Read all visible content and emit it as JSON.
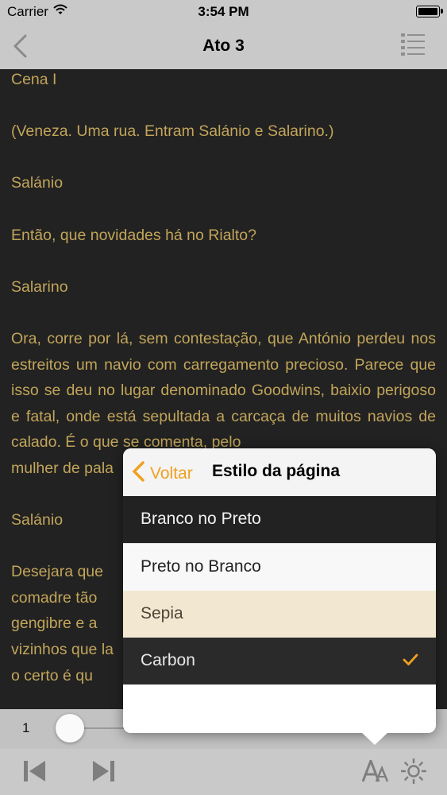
{
  "status_bar": {
    "carrier": "Carrier",
    "time": "3:54 PM"
  },
  "nav": {
    "title": "Ato 3",
    "back_icon": "chevron-left-icon",
    "toc_icon": "list-icon"
  },
  "content": {
    "paragraphs": [
      "Cena I",
      "(Veneza. Uma rua. Entram Salánio e Salarino.)",
      "Salánio",
      "Então, que novidades há no Rialto?",
      "Salarino",
      "Ora, corre por lá, sem contestação, que António perdeu nos estreitos um navio com carregamento precioso. Parece que isso se deu no lugar denominado Goodwins, baixio perigoso e fatal, onde está sepultada a carcaça de muitos navios de calado. É o que se comenta, pelo",
      "mulher de pala",
      "Salánio",
      "Desejara que",
      "comadre  tão",
      "gengibre  e  a",
      "vizinhos que la",
      "o  certo  é  qu"
    ]
  },
  "popover": {
    "back_label": "Voltar",
    "title": "Estilo da página",
    "options": [
      "Branco no Preto",
      "Preto no Branco",
      "Sepia",
      "Carbon"
    ],
    "selected": "Carbon"
  },
  "slider": {
    "page": "1"
  },
  "toolbar": {
    "icons": [
      "skip-back-icon",
      "skip-forward-icon",
      "font-size-icon",
      "brightness-icon"
    ]
  },
  "colors": {
    "text_sepia": "#c2a55a",
    "accent": "#f0a020",
    "background": "#222222"
  }
}
